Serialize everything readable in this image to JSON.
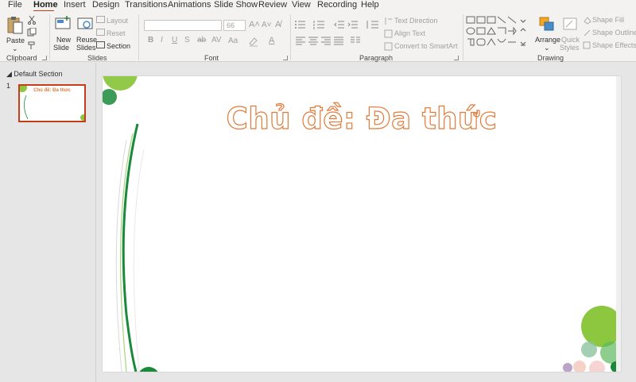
{
  "tabs": [
    "File",
    "Home",
    "Insert",
    "Design",
    "Transitions",
    "Animations",
    "Slide Show",
    "Review",
    "View",
    "Recording",
    "Help"
  ],
  "ribbon": {
    "clipboard": {
      "paste": "Paste",
      "label": "Clipboard"
    },
    "slides": {
      "new_slide_1": "New",
      "new_slide_2": "Slide",
      "reuse_1": "Reuse",
      "reuse_2": "Slides",
      "layout": "Layout",
      "reset": "Reset",
      "section": "Section",
      "label": "Slides"
    },
    "font": {
      "size": "66",
      "label": "Font"
    },
    "paragraph": {
      "text_direction": "Text Direction",
      "align_text": "Align Text",
      "convert_smartart": "Convert to SmartArt",
      "label": "Paragraph"
    },
    "drawing": {
      "arrange": "Arrange",
      "quick_1": "Quick",
      "quick_2": "Styles",
      "shape_fill": "Shape Fill",
      "shape_outline": "Shape Outline",
      "shape_effects": "Shape Effects",
      "label": "Drawing"
    }
  },
  "slide_pane": {
    "section": "Default Section",
    "slide_number": "1",
    "thumb_title": "Chủ đề: Đa thức"
  },
  "slide": {
    "title": "Chủ đề: Đa thức"
  },
  "colors": {
    "accent_tab": "#c43e1c",
    "title_outline": "#e07b39",
    "green_light": "#8dc63f",
    "green_dark": "#1a8a3a"
  }
}
